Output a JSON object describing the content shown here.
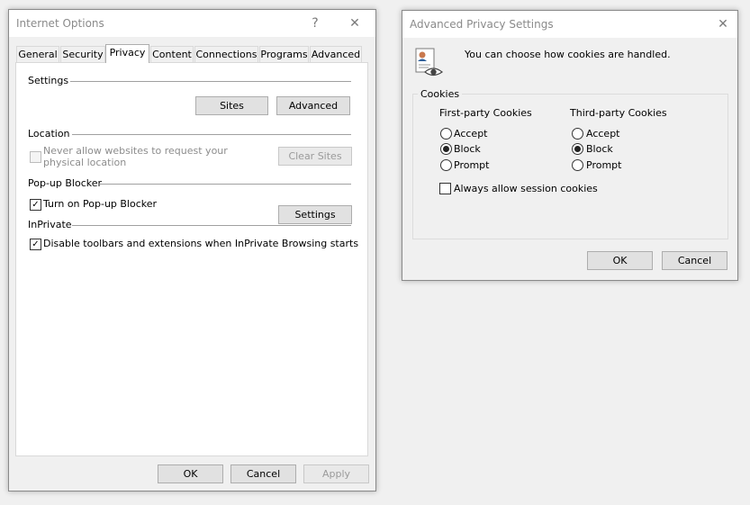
{
  "internet_options": {
    "title": "Internet Options",
    "help_glyph": "?",
    "close_glyph": "✕",
    "tabs": [
      {
        "label": "General"
      },
      {
        "label": "Security"
      },
      {
        "label": "Privacy"
      },
      {
        "label": "Content"
      },
      {
        "label": "Connections"
      },
      {
        "label": "Programs"
      },
      {
        "label": "Advanced"
      }
    ],
    "active_tab": "Privacy",
    "settings_group": {
      "title": "Settings",
      "sites_label": "Sites",
      "advanced_label": "Advanced"
    },
    "location_group": {
      "title": "Location",
      "never_allow_line1": "Never allow websites to request your",
      "never_allow_line2": "physical location",
      "never_allow_checked": false,
      "clear_sites_label": "Clear Sites"
    },
    "popup_group": {
      "title": "Pop-up Blocker",
      "turn_on_label": "Turn on Pop-up Blocker",
      "turn_on_checked": true,
      "settings_label": "Settings"
    },
    "inprivate_group": {
      "title": "InPrivate",
      "disable_toolbars_label": "Disable toolbars and extensions when InPrivate Browsing starts",
      "disable_toolbars_checked": true
    },
    "footer": {
      "ok_label": "OK",
      "cancel_label": "Cancel",
      "apply_label": "Apply"
    },
    "check_glyph": "✓"
  },
  "advanced_privacy": {
    "title": "Advanced Privacy Settings",
    "close_glyph": "✕",
    "description": "You can choose how cookies are handled.",
    "cookies_group": {
      "title": "Cookies",
      "first_party": {
        "header": "First-party Cookies",
        "options": [
          "Accept",
          "Block",
          "Prompt"
        ],
        "selected": "Block"
      },
      "third_party": {
        "header": "Third-party Cookies",
        "options": [
          "Accept",
          "Block",
          "Prompt"
        ],
        "selected": "Block"
      },
      "session_label": "Always allow session cookies",
      "session_checked": false
    },
    "footer": {
      "ok_label": "OK",
      "cancel_label": "Cancel"
    }
  }
}
